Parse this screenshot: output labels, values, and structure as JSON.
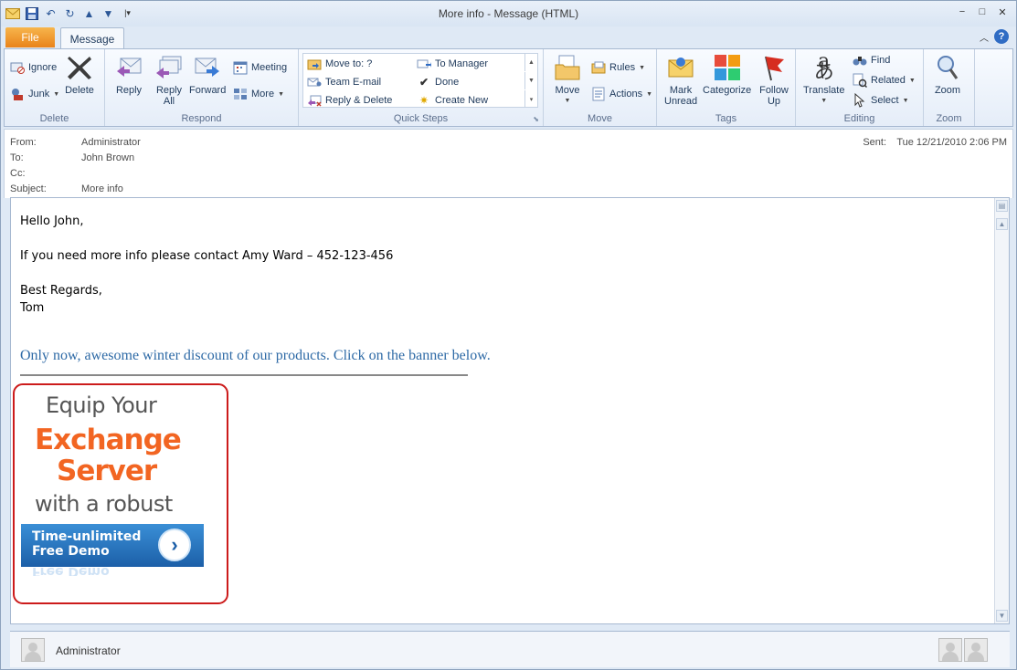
{
  "window": {
    "title": "More info  -  Message (HTML)",
    "controls": [
      "−",
      "□",
      "✕"
    ]
  },
  "tabs": {
    "file": "File",
    "message": "Message"
  },
  "ribbon": {
    "delete": {
      "label": "Delete",
      "ignore": "Ignore",
      "junk": "Junk",
      "delete": "Delete"
    },
    "respond": {
      "label": "Respond",
      "reply": "Reply",
      "reply_all_1": "Reply",
      "reply_all_2": "All",
      "forward": "Forward",
      "meeting": "Meeting",
      "more": "More"
    },
    "quick_steps": {
      "label": "Quick Steps",
      "move_to": "Move to: ?",
      "team_email": "Team E-mail",
      "reply_delete": "Reply & Delete",
      "to_manager": "To Manager",
      "done": "Done",
      "create_new": "Create New"
    },
    "move": {
      "label": "Move",
      "move": "Move",
      "rules": "Rules",
      "actions": "Actions"
    },
    "tags": {
      "label": "Tags",
      "mark_unread_1": "Mark",
      "mark_unread_2": "Unread",
      "categorize": "Categorize",
      "follow_up_1": "Follow",
      "follow_up_2": "Up"
    },
    "editing": {
      "label": "Editing",
      "translate": "Translate",
      "find": "Find",
      "related": "Related",
      "select": "Select"
    },
    "zoom": {
      "label": "Zoom",
      "zoom": "Zoom"
    }
  },
  "header": {
    "from_label": "From:",
    "from_value": "Administrator",
    "to_label": "To:",
    "to_value": "John Brown",
    "cc_label": "Cc:",
    "cc_value": "",
    "subject_label": "Subject:",
    "subject_value": "More info",
    "sent_label": "Sent:",
    "sent_value": "Tue 12/21/2010 2:06 PM"
  },
  "body": {
    "greeting": "Hello John,",
    "line1": "If you need more info please contact Amy Ward – 452-123-456",
    "regards": "Best Regards,",
    "signature": "Tom",
    "promo": "Only now, awesome winter discount of our products. Click on the banner below."
  },
  "banner": {
    "line1": "Equip Your",
    "line2": "Exchange",
    "line3": "Server",
    "line4": "with a robust",
    "cta_line1": "Time-unlimited",
    "cta_line2": "Free Demo",
    "cta_reflection": "Free Demo",
    "border_color": "#cc1b1b",
    "accent_color": "#f26522",
    "cta_color": "#1c5fa8"
  },
  "people_pane": {
    "name": "Administrator"
  }
}
